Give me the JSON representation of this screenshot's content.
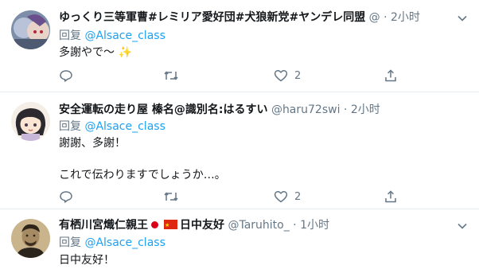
{
  "tweets": [
    {
      "name": "ゆっくり三等軍曹#レミリア愛好団#犬狼新党#ヤンデレ同盟",
      "handle": "@",
      "separator": "·",
      "time": "2小时",
      "reply_prefix": "回复",
      "reply_to": "@Alsace_class",
      "text": "多謝やで～",
      "emoji_icon": "sparkles-icon",
      "reply_count": "",
      "retweet_count": "",
      "like_count": "2"
    },
    {
      "name": "安全運転の走り屋 榛名@識別名:はるすい",
      "handle": "@haru72swi",
      "separator": "·",
      "time": "2小时",
      "reply_prefix": "回复",
      "reply_to": "@Alsace_class",
      "text": "謝謝、多謝！\n\nこれで伝わりますでしょうか…。",
      "reply_count": "",
      "retweet_count": "",
      "like_count": "2"
    },
    {
      "name": "有栖川宮熾仁親王",
      "name_suffix": "日中友好",
      "flags": [
        "japan-flag-icon",
        "china-flag-icon"
      ],
      "handle": "@Taruhito_",
      "separator": "·",
      "time": "1小时",
      "reply_prefix": "回复",
      "reply_to": "@Alsace_class",
      "text": "日中友好！"
    }
  ],
  "colors": {
    "accent": "#1da1f2",
    "secondary_text": "#657786",
    "primary_text": "#14171a",
    "divider": "#e6ecf0"
  }
}
